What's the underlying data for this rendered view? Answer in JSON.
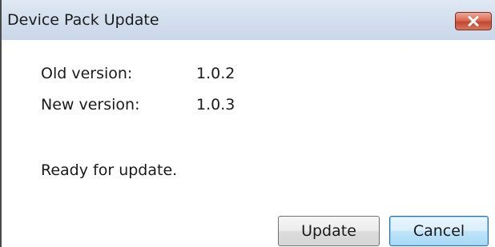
{
  "window": {
    "title": "Device Pack Update"
  },
  "info": {
    "old_version_label": "Old version:",
    "old_version_value": "1.0.2",
    "new_version_label": "New version:",
    "new_version_value": "1.0.3",
    "status": "Ready for update."
  },
  "buttons": {
    "update_label": "Update",
    "cancel_label": "Cancel"
  },
  "icons": {
    "close": "close-icon"
  },
  "colors": {
    "close_button": "#c24832",
    "default_button_border": "#2d6fab",
    "titlebar": "#d4e0ee"
  }
}
